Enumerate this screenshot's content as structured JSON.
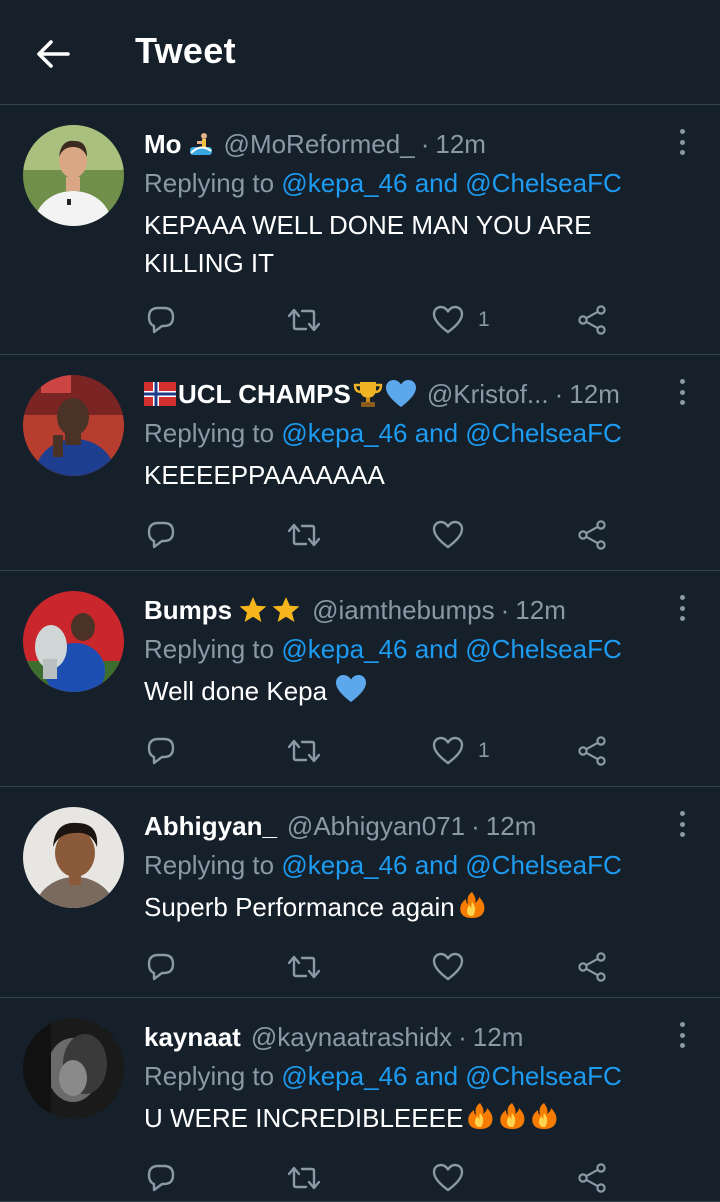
{
  "header": {
    "title": "Tweet"
  },
  "replying_prefix": "Replying to",
  "tweets": [
    {
      "name": "Mo",
      "handle": "@MoReformed_",
      "separator": "·",
      "time": "12m",
      "mentions": "@kepa_46 and @ChelseaFC",
      "text": "KEPAAA WELL DONE MAN YOU ARE KILLING IT",
      "likes": "1"
    },
    {
      "name": "UCL CHAMPS",
      "handle": "@Kristof...",
      "separator": "·",
      "time": "12m",
      "mentions": "@kepa_46 and @ChelseaFC",
      "text": "KEEEEPPAAAAAAA",
      "likes": ""
    },
    {
      "name": "Bumps",
      "handle": "@iamthebumps",
      "separator": "·",
      "time": "12m",
      "mentions": "@kepa_46 and @ChelseaFC",
      "text": "Well done Kepa",
      "likes": "1"
    },
    {
      "name": "Abhigyan_",
      "handle": "@Abhigyan071",
      "separator": "·",
      "time": "12m",
      "mentions": "@kepa_46 and @ChelseaFC",
      "text": "Superb Performance again",
      "likes": ""
    },
    {
      "name": "kaynaat",
      "handle": "@kaynaatrashidx",
      "separator": "·",
      "time": "12m",
      "mentions": "@kepa_46 and @ChelseaFC",
      "text": "U WERE INCREDIBLEEEE",
      "likes": ""
    }
  ],
  "icons": {
    "back": "arrow-left-icon",
    "reply": "reply-icon",
    "retweet": "retweet-icon",
    "like": "heart-icon",
    "share": "share-icon",
    "more": "more-vertical-icon"
  },
  "colors": {
    "background": "#15202b",
    "divider": "#38444d",
    "muted": "#8b98a5",
    "link": "#1d9bf0"
  }
}
